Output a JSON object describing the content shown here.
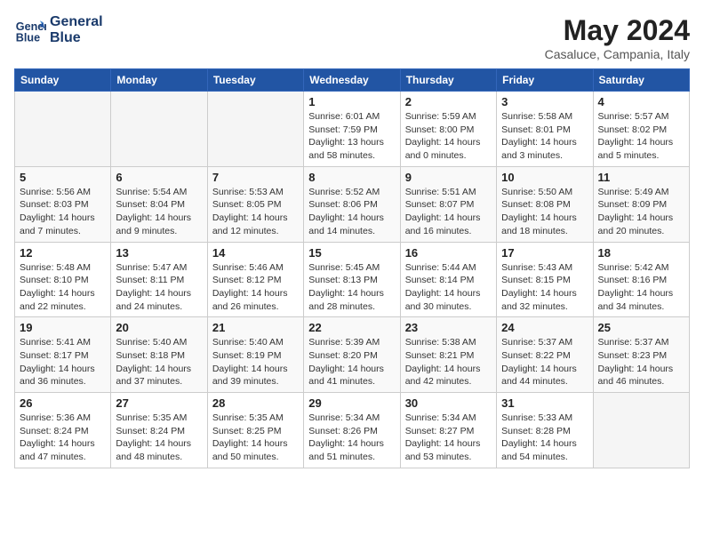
{
  "header": {
    "logo_line1": "General",
    "logo_line2": "Blue",
    "month": "May 2024",
    "location": "Casaluce, Campania, Italy"
  },
  "weekdays": [
    "Sunday",
    "Monday",
    "Tuesday",
    "Wednesday",
    "Thursday",
    "Friday",
    "Saturday"
  ],
  "weeks": [
    [
      {
        "day": "",
        "info": ""
      },
      {
        "day": "",
        "info": ""
      },
      {
        "day": "",
        "info": ""
      },
      {
        "day": "1",
        "info": "Sunrise: 6:01 AM\nSunset: 7:59 PM\nDaylight: 13 hours\nand 58 minutes."
      },
      {
        "day": "2",
        "info": "Sunrise: 5:59 AM\nSunset: 8:00 PM\nDaylight: 14 hours\nand 0 minutes."
      },
      {
        "day": "3",
        "info": "Sunrise: 5:58 AM\nSunset: 8:01 PM\nDaylight: 14 hours\nand 3 minutes."
      },
      {
        "day": "4",
        "info": "Sunrise: 5:57 AM\nSunset: 8:02 PM\nDaylight: 14 hours\nand 5 minutes."
      }
    ],
    [
      {
        "day": "5",
        "info": "Sunrise: 5:56 AM\nSunset: 8:03 PM\nDaylight: 14 hours\nand 7 minutes."
      },
      {
        "day": "6",
        "info": "Sunrise: 5:54 AM\nSunset: 8:04 PM\nDaylight: 14 hours\nand 9 minutes."
      },
      {
        "day": "7",
        "info": "Sunrise: 5:53 AM\nSunset: 8:05 PM\nDaylight: 14 hours\nand 12 minutes."
      },
      {
        "day": "8",
        "info": "Sunrise: 5:52 AM\nSunset: 8:06 PM\nDaylight: 14 hours\nand 14 minutes."
      },
      {
        "day": "9",
        "info": "Sunrise: 5:51 AM\nSunset: 8:07 PM\nDaylight: 14 hours\nand 16 minutes."
      },
      {
        "day": "10",
        "info": "Sunrise: 5:50 AM\nSunset: 8:08 PM\nDaylight: 14 hours\nand 18 minutes."
      },
      {
        "day": "11",
        "info": "Sunrise: 5:49 AM\nSunset: 8:09 PM\nDaylight: 14 hours\nand 20 minutes."
      }
    ],
    [
      {
        "day": "12",
        "info": "Sunrise: 5:48 AM\nSunset: 8:10 PM\nDaylight: 14 hours\nand 22 minutes."
      },
      {
        "day": "13",
        "info": "Sunrise: 5:47 AM\nSunset: 8:11 PM\nDaylight: 14 hours\nand 24 minutes."
      },
      {
        "day": "14",
        "info": "Sunrise: 5:46 AM\nSunset: 8:12 PM\nDaylight: 14 hours\nand 26 minutes."
      },
      {
        "day": "15",
        "info": "Sunrise: 5:45 AM\nSunset: 8:13 PM\nDaylight: 14 hours\nand 28 minutes."
      },
      {
        "day": "16",
        "info": "Sunrise: 5:44 AM\nSunset: 8:14 PM\nDaylight: 14 hours\nand 30 minutes."
      },
      {
        "day": "17",
        "info": "Sunrise: 5:43 AM\nSunset: 8:15 PM\nDaylight: 14 hours\nand 32 minutes."
      },
      {
        "day": "18",
        "info": "Sunrise: 5:42 AM\nSunset: 8:16 PM\nDaylight: 14 hours\nand 34 minutes."
      }
    ],
    [
      {
        "day": "19",
        "info": "Sunrise: 5:41 AM\nSunset: 8:17 PM\nDaylight: 14 hours\nand 36 minutes."
      },
      {
        "day": "20",
        "info": "Sunrise: 5:40 AM\nSunset: 8:18 PM\nDaylight: 14 hours\nand 37 minutes."
      },
      {
        "day": "21",
        "info": "Sunrise: 5:40 AM\nSunset: 8:19 PM\nDaylight: 14 hours\nand 39 minutes."
      },
      {
        "day": "22",
        "info": "Sunrise: 5:39 AM\nSunset: 8:20 PM\nDaylight: 14 hours\nand 41 minutes."
      },
      {
        "day": "23",
        "info": "Sunrise: 5:38 AM\nSunset: 8:21 PM\nDaylight: 14 hours\nand 42 minutes."
      },
      {
        "day": "24",
        "info": "Sunrise: 5:37 AM\nSunset: 8:22 PM\nDaylight: 14 hours\nand 44 minutes."
      },
      {
        "day": "25",
        "info": "Sunrise: 5:37 AM\nSunset: 8:23 PM\nDaylight: 14 hours\nand 46 minutes."
      }
    ],
    [
      {
        "day": "26",
        "info": "Sunrise: 5:36 AM\nSunset: 8:24 PM\nDaylight: 14 hours\nand 47 minutes."
      },
      {
        "day": "27",
        "info": "Sunrise: 5:35 AM\nSunset: 8:24 PM\nDaylight: 14 hours\nand 48 minutes."
      },
      {
        "day": "28",
        "info": "Sunrise: 5:35 AM\nSunset: 8:25 PM\nDaylight: 14 hours\nand 50 minutes."
      },
      {
        "day": "29",
        "info": "Sunrise: 5:34 AM\nSunset: 8:26 PM\nDaylight: 14 hours\nand 51 minutes."
      },
      {
        "day": "30",
        "info": "Sunrise: 5:34 AM\nSunset: 8:27 PM\nDaylight: 14 hours\nand 53 minutes."
      },
      {
        "day": "31",
        "info": "Sunrise: 5:33 AM\nSunset: 8:28 PM\nDaylight: 14 hours\nand 54 minutes."
      },
      {
        "day": "",
        "info": ""
      }
    ]
  ]
}
